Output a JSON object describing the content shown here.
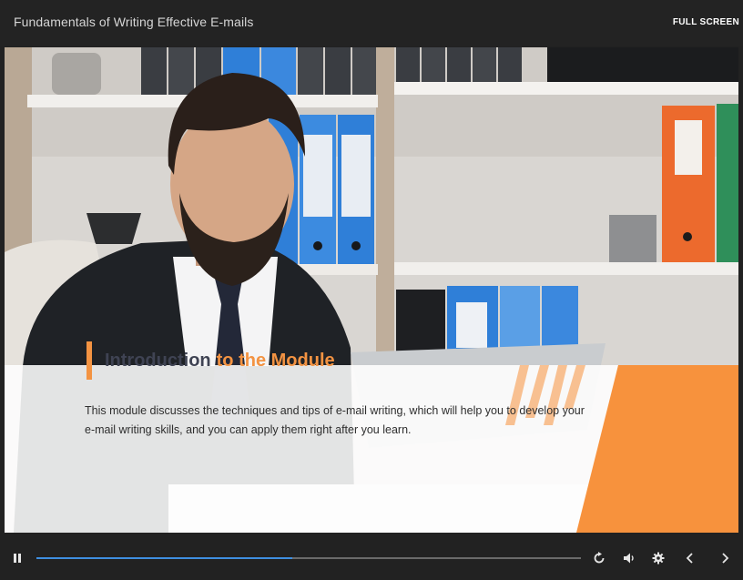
{
  "header": {
    "course_title": "Fundamentals of Writing Effective E-mails",
    "fullscreen_label": "FULL SCREEN"
  },
  "slide": {
    "heading_dark": "Introduction",
    "heading_accent": "to the Module",
    "body": "This module discusses the techniques and tips of e-mail writing, which will help you to develop your e-mail writing skills, and you can apply them right after you learn."
  },
  "player": {
    "progress_fraction": 0.47,
    "icons": [
      "pause-icon",
      "replay-icon",
      "volume-icon",
      "gear-icon",
      "chevron-left-icon",
      "chevron-right-icon"
    ]
  },
  "colors": {
    "accent": "#f39342",
    "heading": "#3f4353",
    "progress": "#3f8fe0",
    "chrome": "#222222"
  }
}
